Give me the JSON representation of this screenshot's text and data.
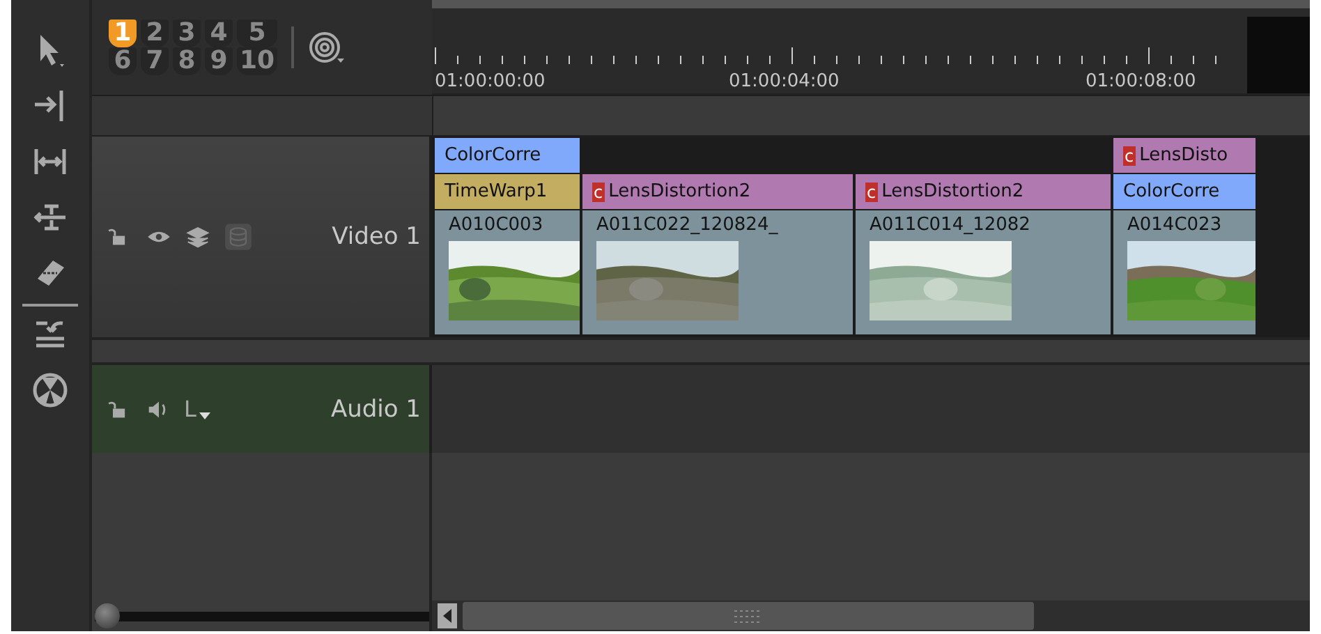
{
  "view_slots": [
    {
      "label": "1",
      "selected": true
    },
    {
      "label": "2",
      "selected": false
    },
    {
      "label": "3",
      "selected": false
    },
    {
      "label": "4",
      "selected": false
    },
    {
      "label": "5",
      "selected": false
    },
    {
      "label": "6",
      "selected": false
    },
    {
      "label": "7",
      "selected": false
    },
    {
      "label": "8",
      "selected": false
    },
    {
      "label": "9",
      "selected": false
    },
    {
      "label": "10",
      "selected": false
    }
  ],
  "ruler": {
    "labels": [
      "01:00:00:00",
      "01:00:04:00",
      "01:00:08:00"
    ]
  },
  "tracks": [
    {
      "kind": "video",
      "name": "Video 1"
    },
    {
      "kind": "audio",
      "name": "Audio 1",
      "channel": "L"
    }
  ],
  "clips": [
    {
      "name": "A010C003",
      "effects": [
        {
          "name": "ColorCorre",
          "color": "#81a9fb"
        },
        {
          "name": "TimeWarp1",
          "color": "#c3ad60"
        }
      ]
    },
    {
      "name": "A011C022_120824_",
      "effects": [
        {
          "name": "LensDistortion2",
          "color": "#b07ab0",
          "badge": "c"
        }
      ]
    },
    {
      "name": "A011C014_12082",
      "effects": [
        {
          "name": "LensDistortion2",
          "color": "#b07ab0",
          "badge": "c"
        }
      ]
    },
    {
      "name": "A014C023",
      "effects": [
        {
          "name": "LensDisto",
          "color": "#b07ab0",
          "badge": "c"
        },
        {
          "name": "ColorCorre",
          "color": "#81a9fb"
        }
      ]
    }
  ],
  "zoom_slider": {
    "level": 0
  }
}
